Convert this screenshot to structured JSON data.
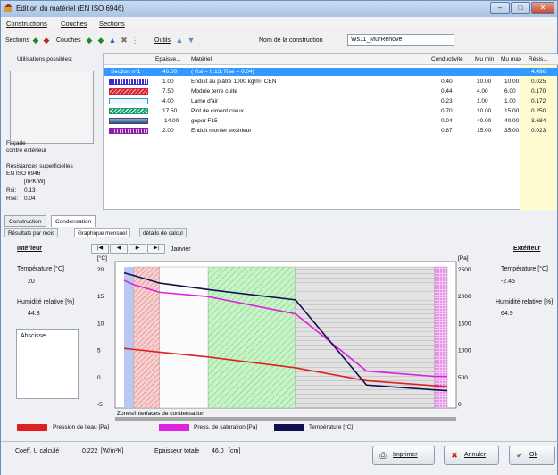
{
  "window": {
    "title": "Edition du matériel (EN ISO 6946)"
  },
  "menu": [
    "Constructions",
    "Couches",
    "Sections"
  ],
  "toolbar": {
    "sections": "Sections",
    "couches": "Couches",
    "outils": "Outils",
    "name_label": "Nom de la construction",
    "name_value": "Ws11_MurRenove"
  },
  "left": {
    "usages_label": "Utilisations possibles:",
    "facade": "Façade",
    "facade2": "contre extérieur",
    "resist_title": "Résistances superficielles",
    "resist_norm": "EN ISO 6946",
    "unit": "[m²K/W]",
    "rsi_label": "Rsi:",
    "rsi": "0.13",
    "rse_label": "Rse:",
    "rse": "0.04"
  },
  "table": {
    "headers": [
      "Epaisse...",
      "Matériel",
      "Conductivité",
      "Mu min",
      "Mu max",
      "Résis..."
    ],
    "rows": [
      {
        "name": "Section n°1",
        "thick": "46.00",
        "mat": "( Rsi = 0.13, Rse = 0.04)",
        "cond": "",
        "mumin": "",
        "mumax": "",
        "res": "4.496"
      },
      {
        "thick": "1.00",
        "mat": "Enduit au plâtre 1000 kg/m³ CEN",
        "cond": "0.40",
        "mumin": "10.00",
        "mumax": "10.00",
        "res": "0.025"
      },
      {
        "thick": "7.50",
        "mat": "Module terre cuite",
        "cond": "0.44",
        "mumin": "4.00",
        "mumax": "6.00",
        "res": "0.170"
      },
      {
        "thick": "4.00",
        "mat": "Lame d'air",
        "cond": "0.23",
        "mumin": "1.00",
        "mumax": "1.00",
        "res": "0.172"
      },
      {
        "thick": "17.50",
        "mat": "Plot de ciment creux",
        "cond": "0.70",
        "mumin": "10.00",
        "mumax": "15.00",
        "res": "0.250"
      },
      {
        "thick": "14.00",
        "mat": "gopor F15",
        "cond": "0.04",
        "mumin": "40.00",
        "mumax": "40.00",
        "res": "3.684"
      },
      {
        "thick": "2.00",
        "mat": "Enduit mortier extérieur",
        "cond": "0.87",
        "mumin": "15.00",
        "mumax": "35.00",
        "res": "0.023"
      }
    ],
    "swatch_colors": [
      "#3a2ad0",
      "#d62233",
      "#2aa0d8",
      "#1aa070",
      "#3a4a7a",
      "#8a1fa8"
    ]
  },
  "tabs": [
    "Construction",
    "Condensation"
  ],
  "subtabs": [
    "Résultats par mois",
    "Graphique mensuel",
    "détails de calcul"
  ],
  "chart_panel": {
    "interieur": "Intérieur",
    "exterieur": "Extérieur",
    "month": "Janvier",
    "temp_label": "Température [°C]",
    "temp_in": "20",
    "temp_out": "-2.45",
    "hum_label": "Humidité relative [%]",
    "hum_in": "44.8",
    "hum_out": "64.9",
    "abscisse": "Abscisse",
    "zones_label": "Zones/Interfaces de condensation"
  },
  "chart_data": {
    "type": "line",
    "xlabel": "",
    "ylabel_left": "[°C]",
    "ylabel_right": "[Pa]",
    "ylim_left": [
      -5,
      20
    ],
    "ylim_right": [
      0,
      2500
    ],
    "left_ticks": [
      "20",
      "15",
      "10",
      "5",
      "0",
      "-5"
    ],
    "right_ticks": [
      "2500",
      "2000",
      "1500",
      "1000",
      "500",
      "0"
    ],
    "series": [
      {
        "name": "Pression de l'eau [Pa]",
        "color": "#e02020",
        "x": [
          0,
          3,
          11,
          26,
          53,
          75,
          100
        ],
        "y_pa": [
          1040,
          1020,
          970,
          880,
          680,
          440,
          330
        ]
      },
      {
        "name": "Press. de saturation [Pa]",
        "color": "#e020e0",
        "x": [
          0,
          3,
          11,
          26,
          53,
          75,
          96,
          100
        ],
        "y_pa": [
          2300,
          2220,
          2080,
          2000,
          1680,
          620,
          520,
          520
        ]
      },
      {
        "name": "Température [°C]",
        "color": "#101050",
        "x": [
          0,
          3,
          11,
          26,
          53,
          75,
          96,
          100
        ],
        "y_c": [
          19.4,
          18.9,
          17.5,
          16.3,
          14.4,
          -1.4,
          -2.3,
          -2.45
        ]
      }
    ],
    "legend": [
      "Pression de l'eau [Pa]",
      "Press. de saturation [Pa]",
      "Température [°C]"
    ]
  },
  "status": {
    "coeff_label": "Coeff. U calculé",
    "coeff_value": "0.222",
    "coeff_unit": "[W/m²K]",
    "thick_label": "Epaisseur totale",
    "thick_value": "46.0",
    "thick_unit": "[cm]"
  },
  "buttons": {
    "print": "Imprimer",
    "cancel": "Annuler",
    "ok": "Ok"
  }
}
